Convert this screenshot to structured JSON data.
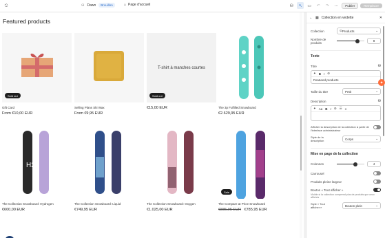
{
  "topbar": {
    "theme_name": "Dawn",
    "draft_badge": "Brouillon",
    "page_selector": "Page d'accueil",
    "publish_label": "Publier",
    "template_label": "Remplacer",
    "more_label": "..."
  },
  "preview": {
    "section_title": "Featured products",
    "products": [
      {
        "title": "Gift Card",
        "price": "From €10,00 EUR",
        "badge": "Sold out",
        "image": "gift-box"
      },
      {
        "title": "Selling Plans Ski Wax",
        "price": "From €9,95 EUR",
        "badge": "",
        "image": "wax-block"
      },
      {
        "title": "",
        "price": "€15,00 EUR",
        "badge": "Sold out",
        "image": "text-tile",
        "image_text": "T-shirt à manches courtes"
      },
      {
        "title": "The 3p Fulfilled Snowboard",
        "price": "€2.629,95 EUR",
        "badge": "",
        "image": "snowboard-teal"
      },
      {
        "title": "The Collection Snowboard: Hydrogen",
        "price": "€600,00 EUR",
        "badge": "",
        "image": "snowboard-hydrogen"
      },
      {
        "title": "The Collection Snowboard: Liquid",
        "price": "€749,95 EUR",
        "badge": "",
        "image": "snowboard-liquid"
      },
      {
        "title": "The Collection Snowboard: Oxygen",
        "price": "€1.025,00 EUR",
        "badge": "",
        "image": "snowboard-oxygen"
      },
      {
        "title": "The Compare at Price Snowboard",
        "price": "€785,95 EUR",
        "compare_price": "€885,95 EUR",
        "badge": "Sale",
        "image": "snowboard-compare"
      }
    ]
  },
  "panel": {
    "title": "Collection en vedette",
    "collection_label": "Collection",
    "collection_value": "Products",
    "count_label": "Nombre de produits",
    "count_value": "8",
    "count_fraction": 0.75,
    "text_section": "Texte",
    "title_label": "Titre",
    "title_value": "Featured products",
    "title_size_label": "Taille du titre",
    "title_size_value": "Petit",
    "description_label": "Description",
    "description_toolbar": "Aa",
    "show_description_label": "Afficher la description de la collection à partir de l'interface administrateur",
    "description_style_label": "Style de la description",
    "description_style_value": "Corps",
    "layout_section": "Mise en page de la collection",
    "columns_label": "Colonnes",
    "columns_value": "4",
    "columns_fraction": 0.67,
    "carousel_label": "Carrousel",
    "full_width_label": "Produits pleine largeur",
    "view_all_label": "Bouton « Tout afficher »",
    "view_all_help": "Visible si la collection comprend plus de produits que ceux affichés",
    "view_all_style_label": "Style « Tout afficher »",
    "view_all_style_value": "Bouton plein"
  }
}
